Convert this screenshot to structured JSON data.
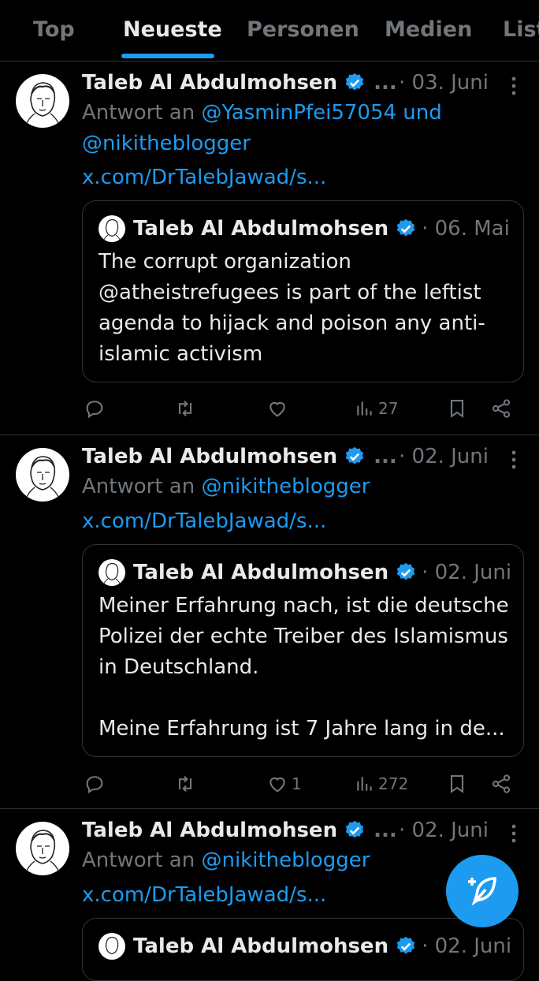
{
  "tabs": [
    {
      "label": "Top"
    },
    {
      "label": "Neueste"
    },
    {
      "label": "Personen"
    },
    {
      "label": "Medien"
    },
    {
      "label": "List"
    }
  ],
  "colors": {
    "accent": "#1d9bf0",
    "muted": "#71767b",
    "text": "#e7e9ea",
    "background": "#000000"
  },
  "tweets": [
    {
      "author": "Taleb Al Abdulmohsen",
      "ellipsis": "...",
      "date": "· 03. Juni",
      "reply_prefix": "Antwort an ",
      "reply_to": "@YasminPfei57054 und @nikitheblogger",
      "url": "x.com/DrTalebJawad/s...",
      "quote": {
        "author": "Taleb Al Abdulmohsen",
        "date": "· 06. Mai",
        "text": "The corrupt organization @atheistrefugees is part of the leftist agenda to hijack and poison any anti-islamic activism"
      },
      "likes": "",
      "views": "27"
    },
    {
      "author": "Taleb Al Abdulmohsen",
      "ellipsis": "...",
      "date": "· 02. Juni",
      "reply_prefix": "Antwort an ",
      "reply_to": "@nikitheblogger",
      "url": "x.com/DrTalebJawad/s...",
      "quote": {
        "author": "Taleb Al Abdulmohsen",
        "date": "· 02. Juni",
        "text": "Meiner Erfahrung nach, ist die deutsche Polizei der echte Treiber des Islamismus in Deutschland.\n\nMeine Erfahrung ist 7 Jahre lang in de..."
      },
      "likes": "1",
      "views": "272"
    },
    {
      "author": "Taleb Al Abdulmohsen",
      "ellipsis": "...",
      "date": "· 02. Juni",
      "reply_prefix": "Antwort an ",
      "reply_to": "@nikitheblogger",
      "url": "x.com/DrTalebJawad/s...",
      "quote": {
        "author": "Taleb Al Abdulmohsen",
        "date": "· 02. Juni"
      }
    }
  ],
  "icons": [
    "verified-badge-icon",
    "more-icon",
    "reply-icon",
    "retweet-icon",
    "like-icon",
    "views-icon",
    "bookmark-icon",
    "share-icon",
    "compose-icon"
  ]
}
